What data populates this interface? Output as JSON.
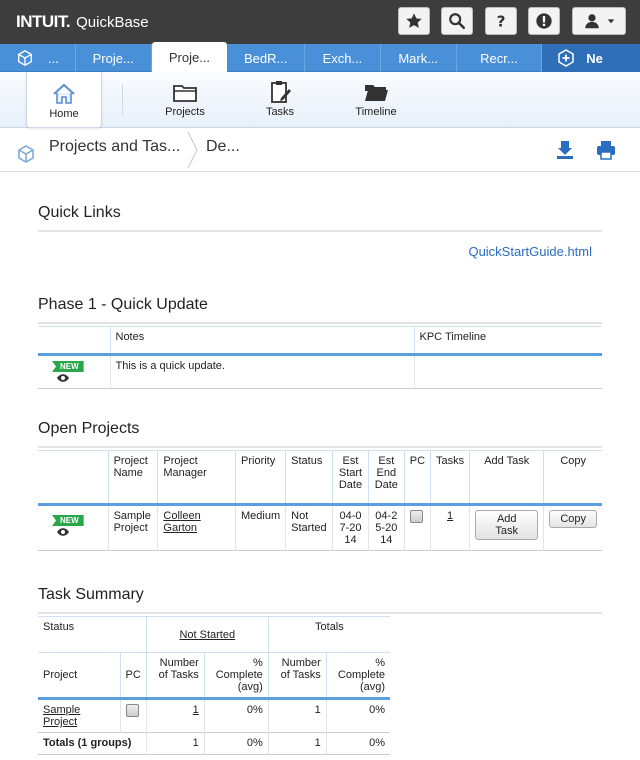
{
  "brand": {
    "intuit": "INTUIT.",
    "product": "QuickBase"
  },
  "colors": {
    "topbar": "#3d3d3d",
    "tabbar": "#4a90d9",
    "accent": "#5aa0e0",
    "new_badge": "#2aa74a",
    "link": "#2a6cc0"
  },
  "topbar_icons": [
    "star-icon",
    "search-icon",
    "help-icon",
    "alert-icon",
    "user-icon"
  ],
  "tabs": [
    {
      "label": "..."
    },
    {
      "label": "Proje..."
    },
    {
      "label": "Proje...",
      "active": true
    },
    {
      "label": "BedR..."
    },
    {
      "label": "Exch..."
    },
    {
      "label": "Mark..."
    },
    {
      "label": "Recr..."
    },
    {
      "label": "Ne"
    }
  ],
  "nav": {
    "home": "Home",
    "projects": "Projects",
    "tasks": "Tasks",
    "timeline": "Timeline"
  },
  "breadcrumb": {
    "app": "Projects and Tas...",
    "page": "De..."
  },
  "quick_links": {
    "title": "Quick Links",
    "link": "QuickStartGuide.html"
  },
  "phase": {
    "title": "Phase 1 - Quick Update",
    "headers": {
      "notes": "Notes",
      "kpc": "KPC Timeline"
    },
    "row": {
      "badge": "NEW",
      "notes": "This is a quick update.",
      "kpc": ""
    }
  },
  "open_projects": {
    "title": "Open Projects",
    "headers": {
      "name": "Project Name",
      "manager": "Project Manager",
      "priority": "Priority",
      "status": "Status",
      "est_start": "Est Start Date",
      "est_end": "Est End Date",
      "pc": "PC",
      "tasks": "Tasks",
      "add_task": "Add Task",
      "copy": "Copy"
    },
    "row": {
      "badge": "NEW",
      "name": "Sample Project",
      "manager": "Colleen Garton",
      "priority": "Medium",
      "status": "Not Started",
      "est_start": "04-07-2014",
      "est_end": "04-25-2014",
      "tasks": "1",
      "add_task_btn": "Add Task",
      "copy_btn": "Copy"
    }
  },
  "task_summary": {
    "title": "Task Summary",
    "group_headers": {
      "status": "Status",
      "not_started": "Not Started",
      "totals": "Totals"
    },
    "headers": {
      "project": "Project",
      "pc": "PC",
      "num_tasks": "Number of Tasks",
      "pct_complete": "% Complete (avg)"
    },
    "row": {
      "project": "Sample Project",
      "ns_num": "1",
      "ns_pct": "0%",
      "t_num": "1",
      "t_pct": "0%"
    },
    "totals": {
      "label": "Totals (1 groups)",
      "ns_num": "1",
      "ns_pct": "0%",
      "t_num": "1",
      "t_pct": "0%"
    }
  }
}
